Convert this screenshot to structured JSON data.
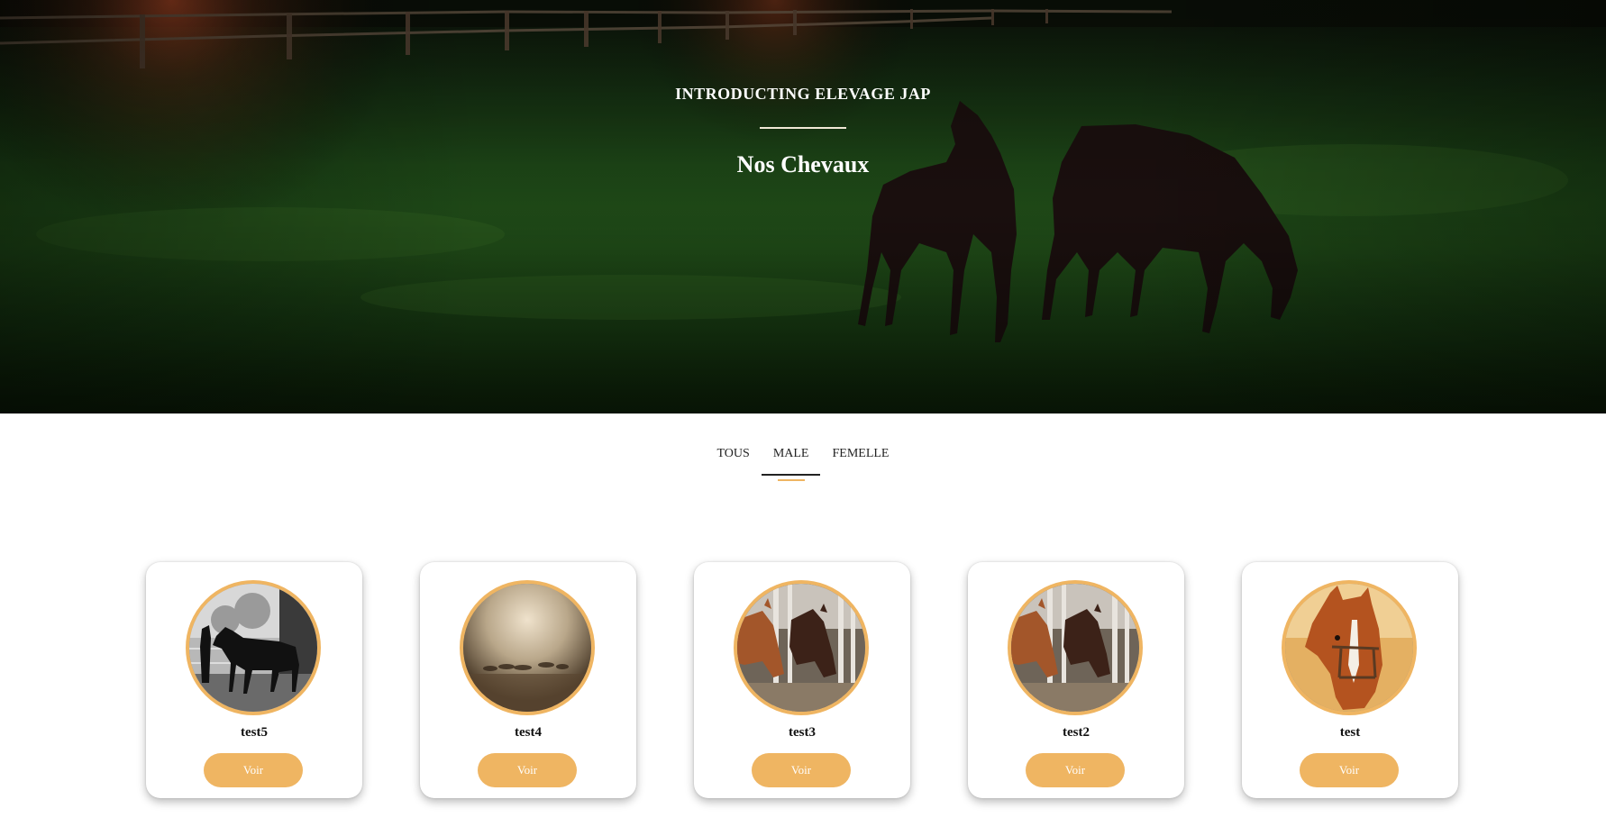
{
  "hero": {
    "kicker": "INTRODUCTING ELEVAGE JAP",
    "title": "Nos Chevaux"
  },
  "filters": {
    "tabs": [
      {
        "label": "TOUS",
        "active": false
      },
      {
        "label": "MALE",
        "active": true
      },
      {
        "label": "FEMELLE",
        "active": false
      }
    ]
  },
  "horses": [
    {
      "name": "test5",
      "button": "Voir",
      "photo": "horse-silhouette-bw"
    },
    {
      "name": "test4",
      "button": "Voir",
      "photo": "horses-misty-field"
    },
    {
      "name": "test3",
      "button": "Voir",
      "photo": "horses-in-stable"
    },
    {
      "name": "test2",
      "button": "Voir",
      "photo": "horses-in-stable"
    },
    {
      "name": "test",
      "button": "Voir",
      "photo": "chestnut-horse-portrait"
    }
  ],
  "colors": {
    "accent": "#efb562",
    "text": "#222222",
    "background": "#ffffff"
  }
}
